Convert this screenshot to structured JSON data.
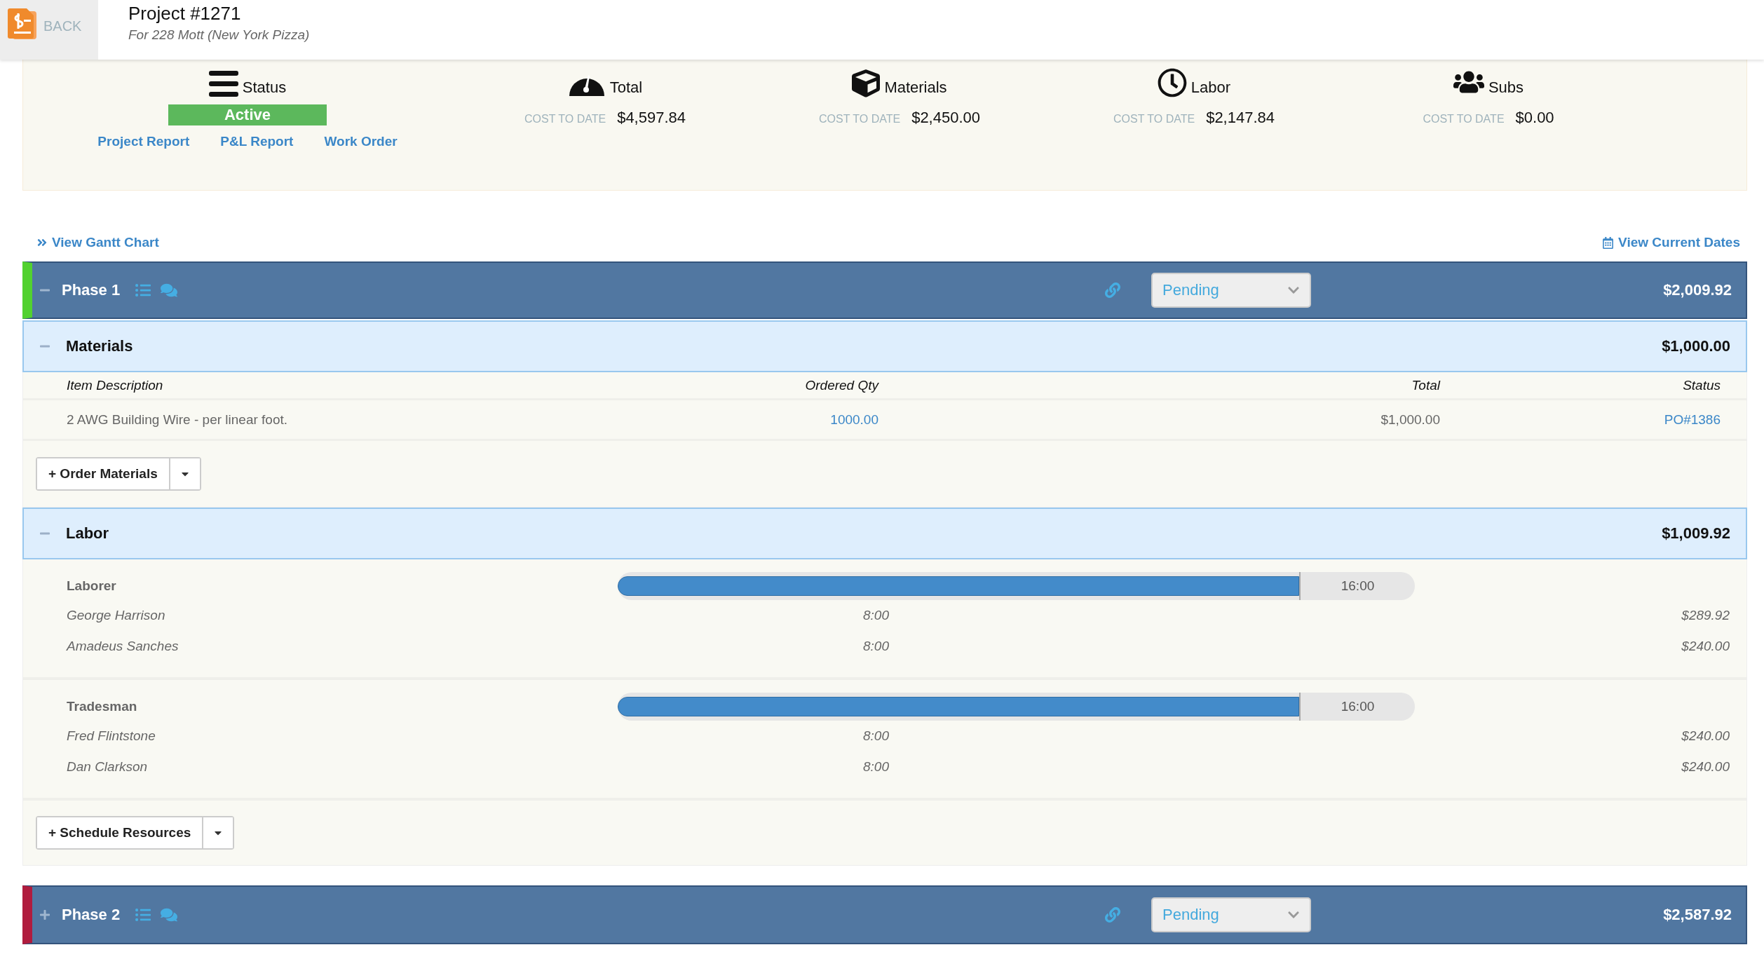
{
  "header": {
    "back_label": "BACK",
    "title": "Project #1271",
    "subtitle": "For 228 Mott (New York Pizza)"
  },
  "summary": {
    "status": {
      "label": "Status",
      "value": "Active",
      "links": [
        "Project Report",
        "P&L Report",
        "Work Order"
      ]
    },
    "costs": [
      {
        "kind": "gauge",
        "label": "Total",
        "caption": "COST TO DATE",
        "amount": "$4,597.84"
      },
      {
        "kind": "box",
        "label": "Materials",
        "caption": "COST TO DATE",
        "amount": "$2,450.00"
      },
      {
        "kind": "clock",
        "label": "Labor",
        "caption": "COST TO DATE",
        "amount": "$2,147.84"
      },
      {
        "kind": "people",
        "label": "Subs",
        "caption": "COST TO DATE",
        "amount": "$0.00"
      }
    ]
  },
  "toolbar": {
    "gantt_link": "View Gantt Chart",
    "dates_link": "View Current Dates"
  },
  "phases": [
    {
      "name": "Phase 1",
      "expanded": true,
      "color": "#52d12f",
      "status": "Pending",
      "total": "$2,009.92",
      "sections": [
        {
          "kind": "materials",
          "title": "Materials",
          "expanded": true,
          "total": "$1,000.00",
          "columns": [
            "Item Description",
            "Ordered Qty",
            "Total",
            "Status"
          ],
          "rows": [
            {
              "description": "2 AWG Building Wire - per linear foot.",
              "qty": "1000.00",
              "total": "$1,000.00",
              "status": "PO#1386"
            }
          ],
          "button": "+ Order Materials"
        },
        {
          "kind": "labor",
          "title": "Labor",
          "expanded": true,
          "total": "$1,009.92",
          "groups": [
            {
              "role": "Laborer",
              "level": 1,
              "reading": "16:00",
              "people": [
                {
                  "name": "George Harrison",
                  "hours": "8:00",
                  "cost": "$289.92"
                },
                {
                  "name": "Amadeus Sanches",
                  "hours": "8:00",
                  "cost": "$240.00"
                }
              ]
            },
            {
              "role": "Tradesman",
              "level": 1,
              "reading": "16:00",
              "people": [
                {
                  "name": "Fred Flintstone",
                  "hours": "8:00",
                  "cost": "$240.00"
                },
                {
                  "name": "Dan Clarkson",
                  "hours": "8:00",
                  "cost": "$240.00"
                }
              ]
            }
          ],
          "button": "+ Schedule Resources"
        }
      ]
    },
    {
      "name": "Phase 2",
      "expanded": false,
      "color": "#b01c3e",
      "status": "Pending",
      "total": "$2,587.92"
    }
  ]
}
